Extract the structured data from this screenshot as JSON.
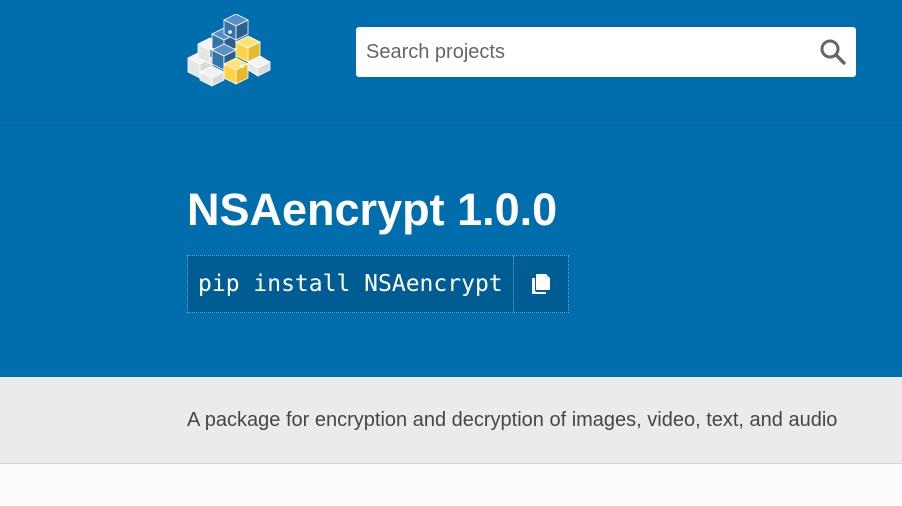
{
  "header": {
    "logo_icon": "pypi-logo-icon",
    "search": {
      "placeholder": "Search projects",
      "value": "",
      "button_icon": "search-icon"
    },
    "colors": {
      "brand_blue": "#006dad",
      "python_yellow": "#ffd343",
      "python_blue": "#3775a9"
    }
  },
  "package": {
    "title": "NSAencrypt 1.0.0",
    "pip_command": "pip install NSAencrypt",
    "copy_icon": "copy-icon"
  },
  "summary": {
    "text": "A package for encryption and decryption of images, video, text, and audio"
  }
}
